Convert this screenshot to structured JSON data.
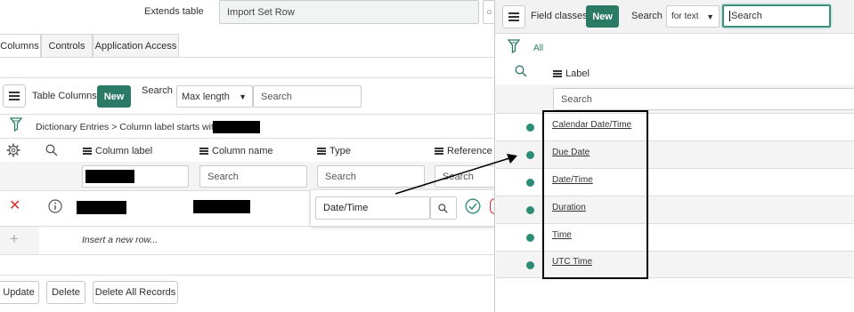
{
  "top": {
    "extends_label": "Extends table",
    "extends_value": "Import Set Row"
  },
  "tabs": [
    {
      "label": "Columns",
      "active": true
    },
    {
      "label": "Controls",
      "active": false
    },
    {
      "label": "Application Access",
      "active": false
    }
  ],
  "columns_toolbar": {
    "title": "Table Columns",
    "new_label": "New",
    "search_label": "Search",
    "search_field_value": "Max length",
    "search_placeholder": "Search"
  },
  "breadcrumb": {
    "text": "Dictionary Entries > Column label starts with"
  },
  "table": {
    "headers": {
      "column_label": "Column label",
      "column_name": "Column name",
      "type": "Type",
      "reference": "Reference"
    },
    "filter_placeholder": "Search",
    "row": {
      "type_value": "Date/Time"
    },
    "insert_row_text": "Insert a new row...",
    "plus": "+"
  },
  "footer_buttons": {
    "update": "Update",
    "delete": "Delete",
    "delete_all": "Delete All Records"
  },
  "field_classes": {
    "title": "Field classes",
    "new_label": "New",
    "search_label": "Search",
    "search_field_value": "for text",
    "search_placeholder": "Search",
    "all_label": "All",
    "column_label": "Label",
    "filter_placeholder": "Search",
    "items": [
      "Calendar Date/Time",
      "Due Date",
      "Date/Time",
      "Duration",
      "Time",
      "UTC Time"
    ]
  },
  "colors": {
    "accent_green": "#2b7a66",
    "dot_green": "#2b8c77",
    "delete_red": "#d9302f"
  }
}
